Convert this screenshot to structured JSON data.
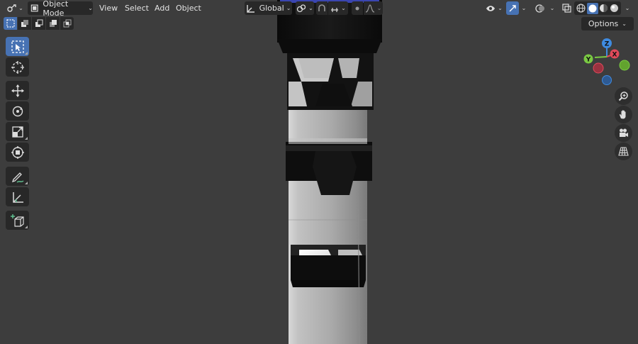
{
  "header": {
    "mode_label": "Object Mode",
    "menus": [
      "View",
      "Select",
      "Add",
      "Object"
    ],
    "transform_orientation": "Global"
  },
  "options_label": "Options",
  "toolbar": {
    "tools": [
      "select-box",
      "cursor",
      "move",
      "rotate",
      "scale",
      "transform",
      "annotate",
      "measure",
      "add-cube"
    ]
  },
  "gizmo": {
    "x": "X",
    "y": "Y",
    "z": "Z"
  },
  "colors": {
    "background": "#3d3d3d",
    "header_button": "#282828",
    "accent": "#4772b3",
    "axis_x": "#e04a5a",
    "axis_y": "#7ac943",
    "axis_z": "#3f8be0",
    "model_body": "#a8a8a8",
    "model_bands": "#101010"
  },
  "icons": [
    "editor-type-icon",
    "object-mode-icon",
    "global-orientation-icon",
    "pivot-icon",
    "snap-icon",
    "proportional-icon",
    "visibility-icon",
    "gizmo-icon",
    "overlay-icon",
    "xray-icon",
    "shading-wire-icon",
    "shading-solid-icon",
    "shading-material-icon",
    "shading-rendered-icon",
    "zoom-icon",
    "hand-icon",
    "camera-icon",
    "grid-icon"
  ]
}
